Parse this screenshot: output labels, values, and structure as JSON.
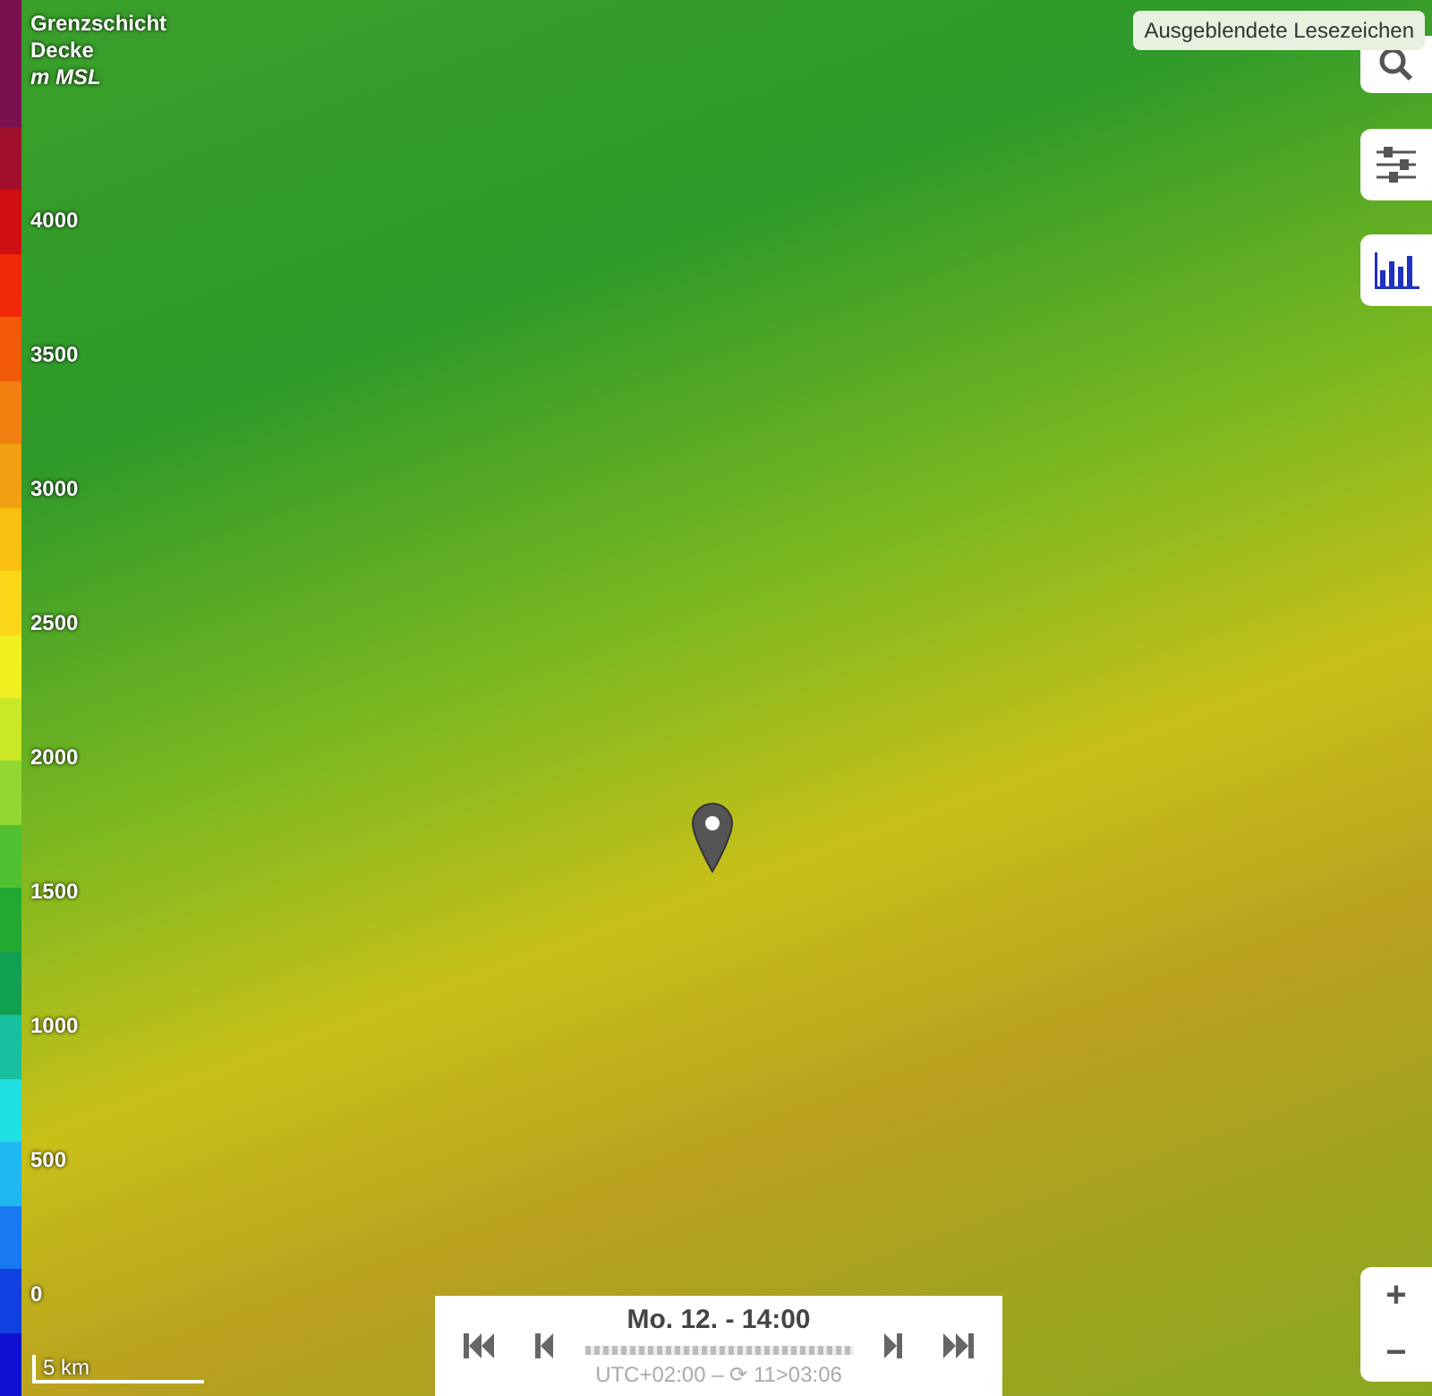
{
  "legend": {
    "title": "Grenzschicht Decke",
    "unit": "m MSL",
    "labels": [
      "4000",
      "3500",
      "3000",
      "2500",
      "2000",
      "1500",
      "1000",
      "500",
      "0"
    ],
    "steps": [
      {
        "color": "#7b1050"
      },
      {
        "color": "#7b1050"
      },
      {
        "color": "#a0102a"
      },
      {
        "color": "#d01010"
      },
      {
        "color": "#f02808"
      },
      {
        "color": "#f05a08"
      },
      {
        "color": "#f08010"
      },
      {
        "color": "#f0a010"
      },
      {
        "color": "#f8c010"
      },
      {
        "color": "#f8d818"
      },
      {
        "color": "#f0f020"
      },
      {
        "color": "#c8e828"
      },
      {
        "color": "#90d830"
      },
      {
        "color": "#50c030"
      },
      {
        "color": "#20a830"
      },
      {
        "color": "#10a050"
      },
      {
        "color": "#18c0a0"
      },
      {
        "color": "#20e0e0"
      },
      {
        "color": "#20b8f0"
      },
      {
        "color": "#1878f0"
      },
      {
        "color": "#1040e0"
      },
      {
        "color": "#1010d0"
      }
    ]
  },
  "tooltip": "Ausgeblendete Lesezeichen",
  "time": {
    "label": "Mo. 12. - 14:00",
    "info": "UTC+02:00 – ⟳ 11>03:06"
  },
  "zoom": {
    "in": "+",
    "out": "−"
  },
  "scale": "5 km"
}
